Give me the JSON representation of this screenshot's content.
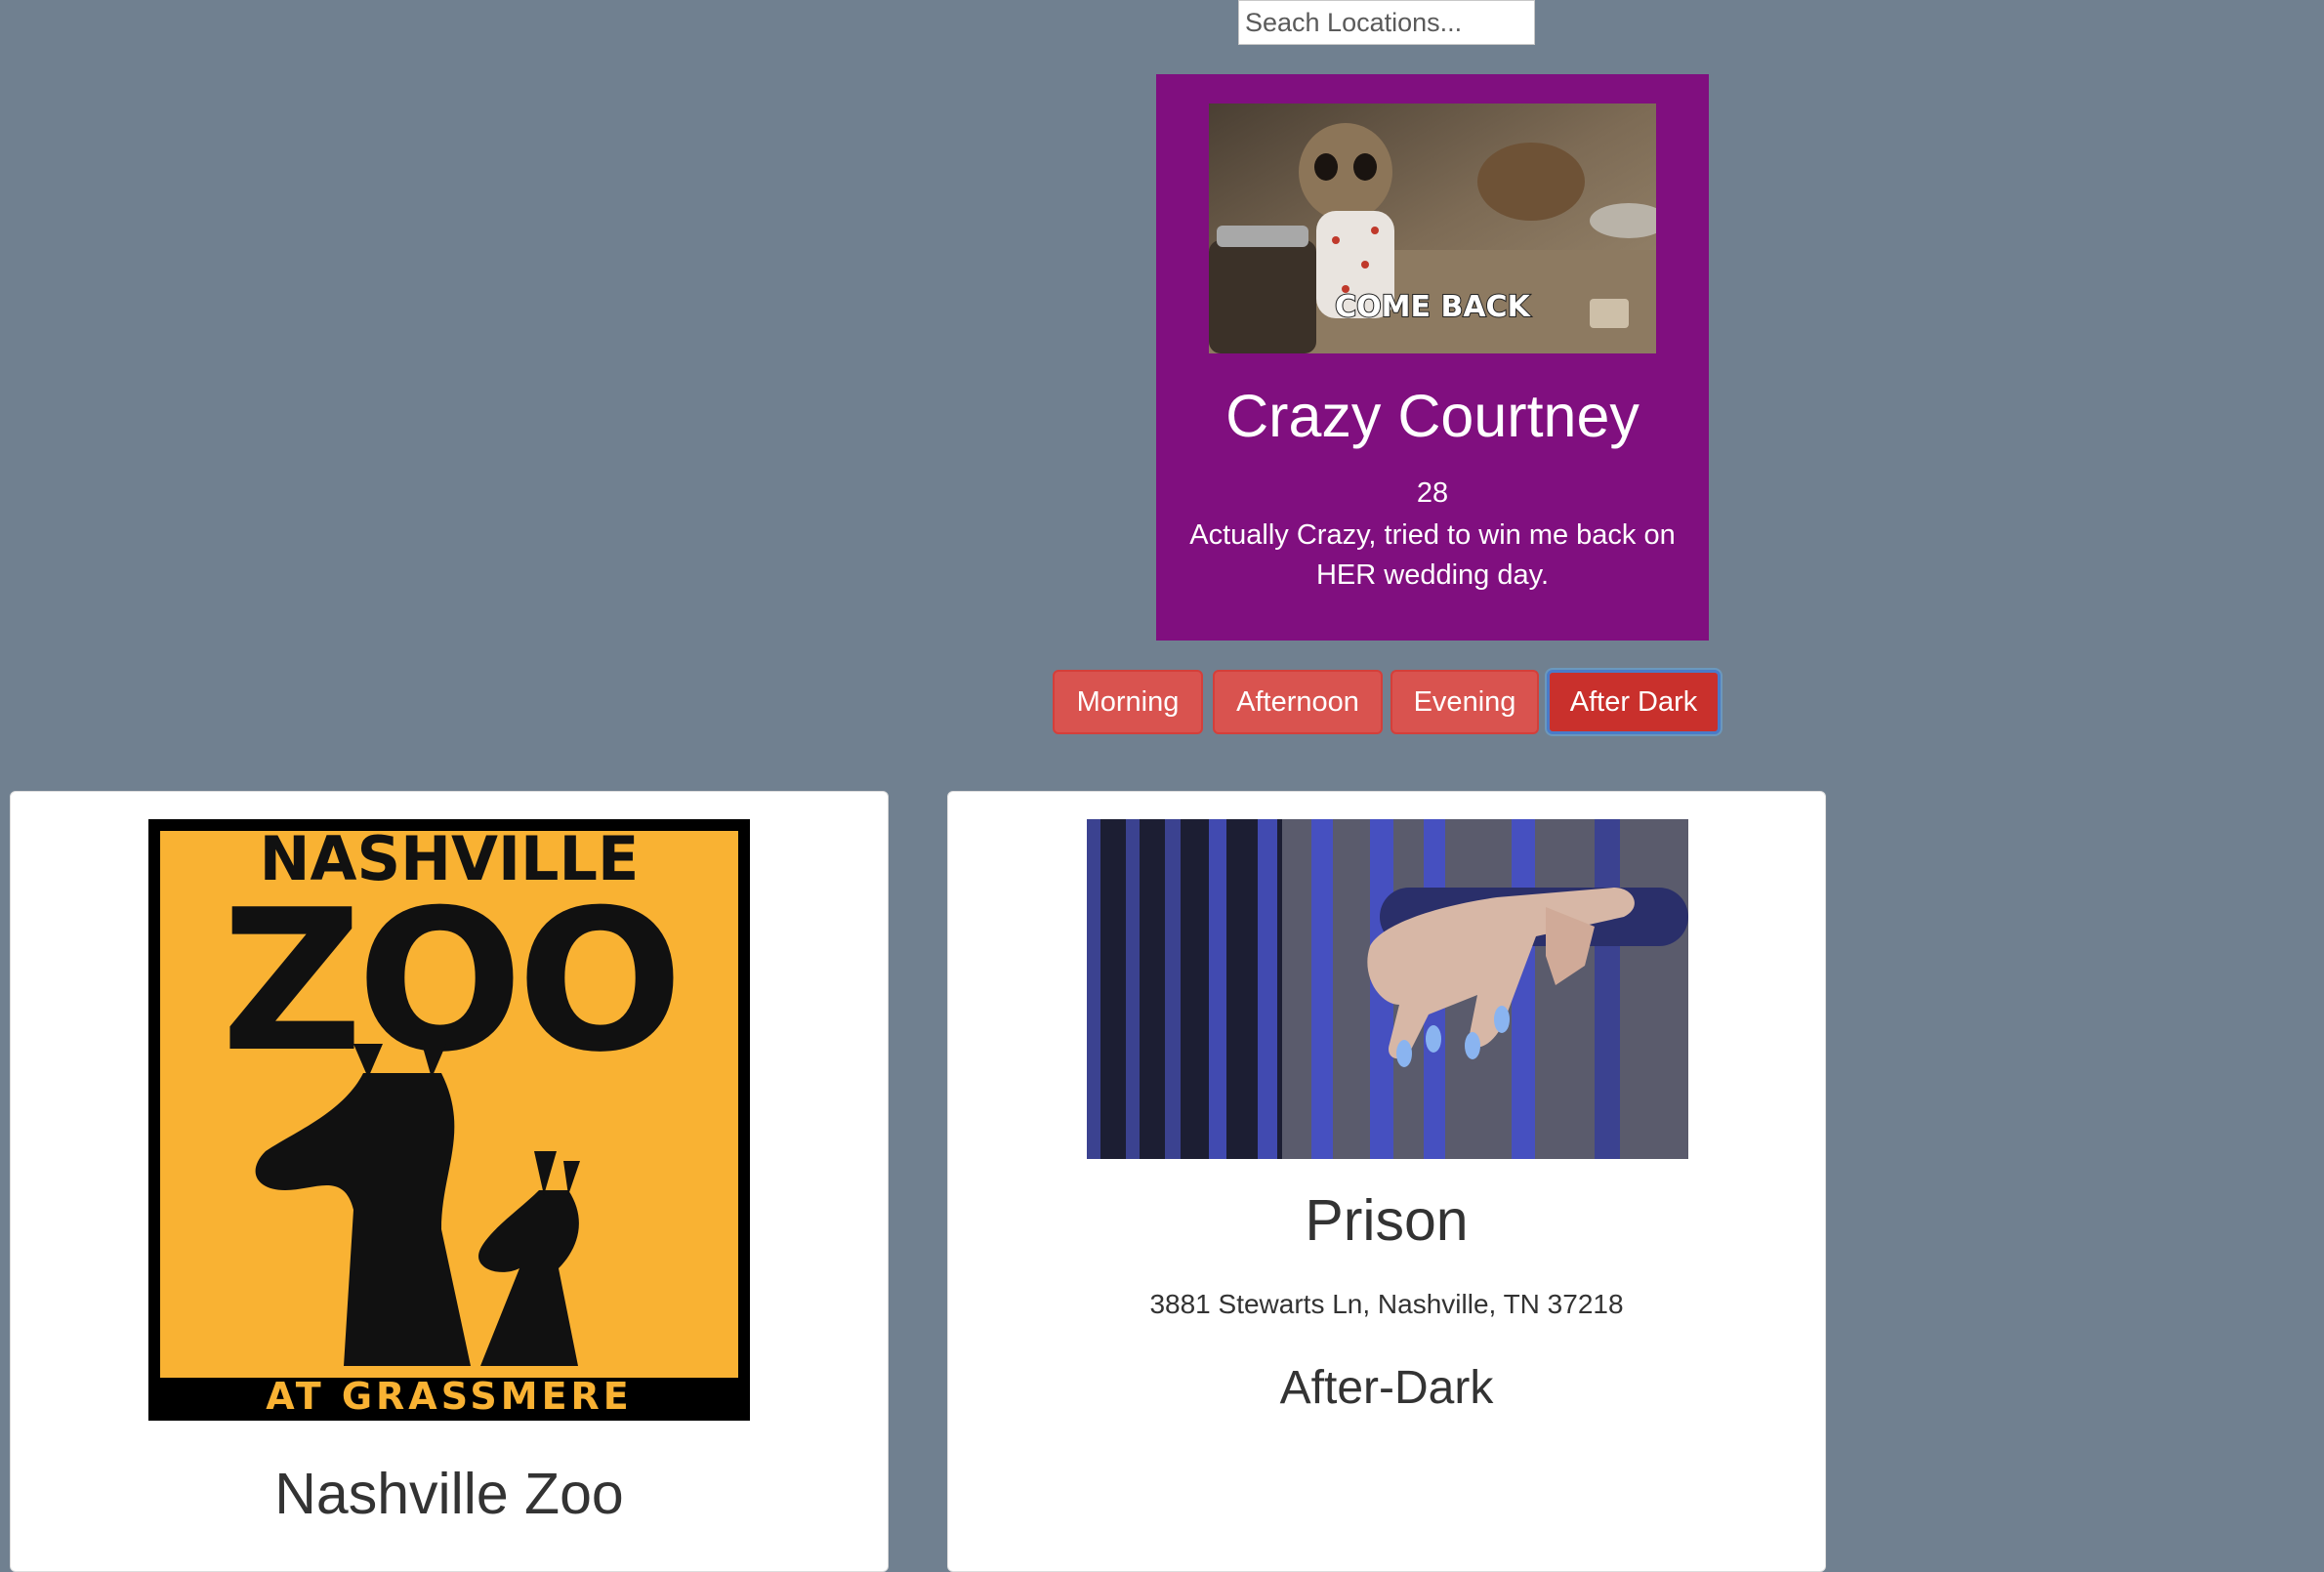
{
  "search": {
    "placeholder": "Seach Locations..."
  },
  "profile": {
    "photo_caption": "COME BACK",
    "name": "Crazy Courtney",
    "age": "28",
    "bio": "Actually Crazy, tried to win me back on HER wedding day."
  },
  "time_filters": {
    "buttons": [
      {
        "label": "Morning"
      },
      {
        "label": "Afternoon"
      },
      {
        "label": "Evening"
      },
      {
        "label": "After Dark"
      }
    ],
    "selected": "After Dark"
  },
  "locations": [
    {
      "name": "Nashville Zoo",
      "logo_text_top": "NASHVILLE",
      "logo_text_main": "ZOO",
      "logo_text_bottom": "AT GRASSMERE"
    },
    {
      "name": "Prison",
      "address": "3881 Stewarts Ln, Nashville, TN 37218",
      "time_of_day": "After-Dark"
    }
  ],
  "colors": {
    "background": "#708090",
    "profile_card": "#800f7f",
    "button": "#d9534f",
    "button_active": "#c9302c",
    "zoo_logo_bg": "#f9b233"
  }
}
